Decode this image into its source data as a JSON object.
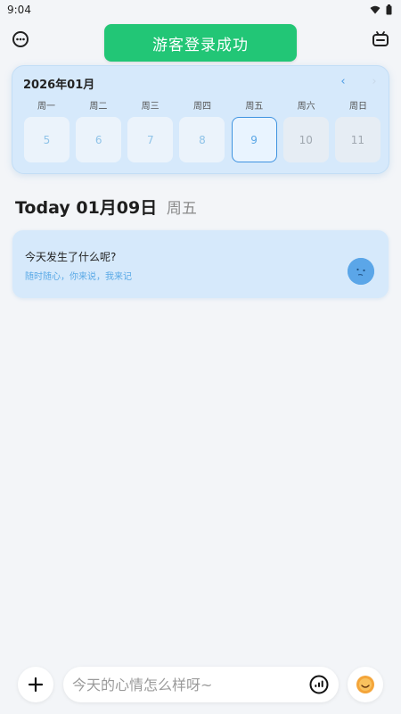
{
  "status_bar": {
    "time": "9:04",
    "icons": [
      "wifi-icon",
      "battery-icon"
    ]
  },
  "header": {
    "left_icon": "more-icon",
    "right_icon": "tv-icon"
  },
  "toast": {
    "message": "游客登录成功",
    "color": "#22c676"
  },
  "calendar": {
    "month_label": "2026年01月",
    "weekdays": [
      "周一",
      "周二",
      "周三",
      "周四",
      "周五",
      "周六",
      "周日"
    ],
    "days": [
      "5",
      "6",
      "7",
      "8",
      "9",
      "10",
      "11"
    ],
    "selected_day": "9",
    "accent": "#3f93e0"
  },
  "today": {
    "prefix": "Today",
    "date": "01月09日",
    "weekday": "周五"
  },
  "entry": {
    "title": "今天发生了什么呢?",
    "subtitle": "随时随心，你来说，我来记",
    "icon": "mood-face-icon"
  },
  "composer": {
    "placeholder": "今天的心情怎么样呀~",
    "add_icon": "plus-icon",
    "voice_icon": "voice-icon",
    "emoji_icon": "smiley-icon"
  }
}
